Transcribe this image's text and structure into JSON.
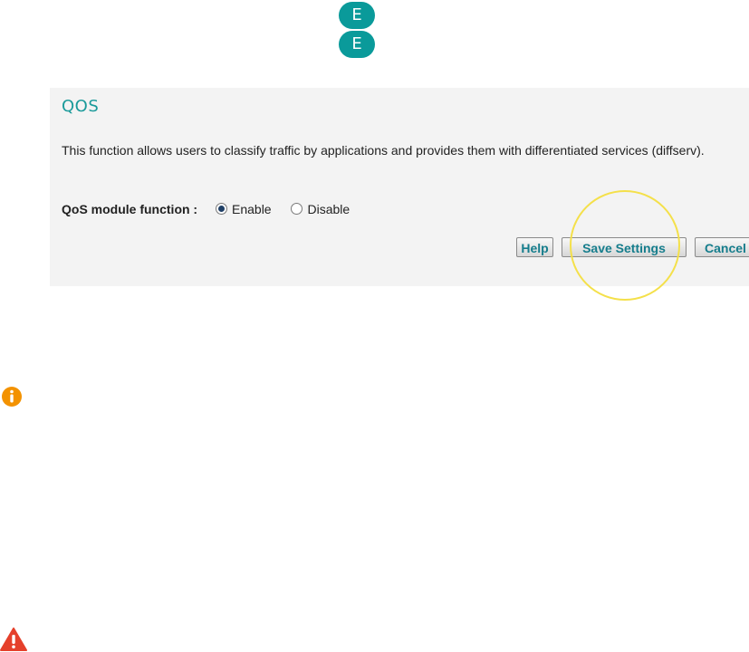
{
  "brand": {
    "logo_letter_top": "E",
    "logo_letter_bottom": "E",
    "color": "#0a9a9a"
  },
  "panel": {
    "title": "QOS",
    "description": "This function allows users to classify traffic by applications and provides them with differentiated services (diffserv).",
    "qos_label": "QoS module function :",
    "options": [
      {
        "label": "Enable",
        "selected": true
      },
      {
        "label": "Disable",
        "selected": false
      }
    ],
    "buttons": {
      "help": "Help",
      "save": "Save Settings",
      "cancel": "Cancel"
    }
  },
  "icons": {
    "info": "info-icon",
    "warning": "warning-icon",
    "info_color": "#f39200",
    "warning_color": "#e5402b",
    "highlight_color": "#f4e04a"
  }
}
